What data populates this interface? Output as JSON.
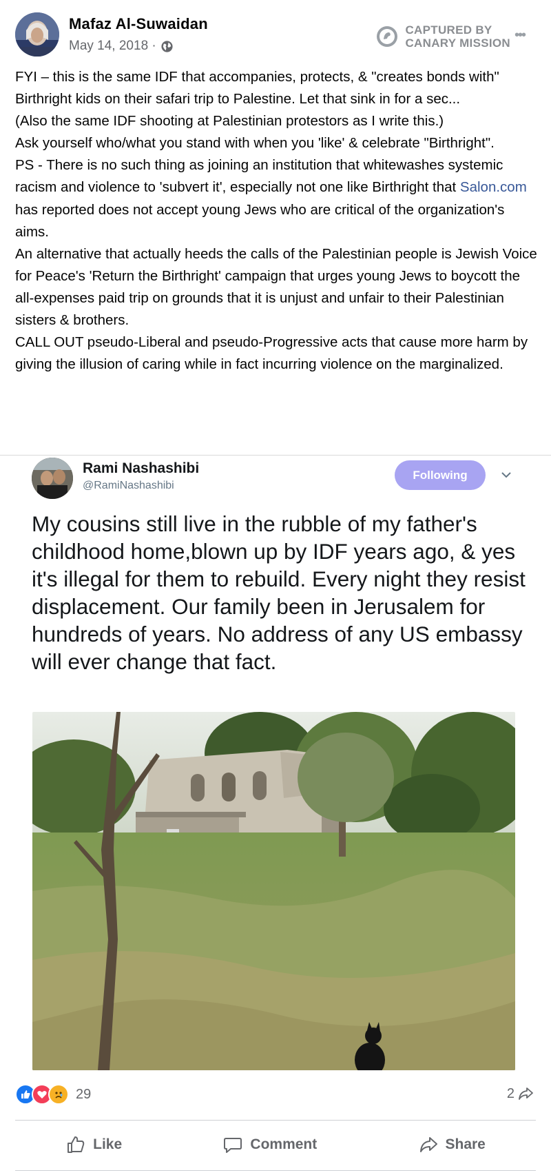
{
  "post": {
    "author": "Mafaz Al-Suwaidan",
    "date": "May 14, 2018 ·",
    "audience_icon": "globe-icon",
    "captured_line1": "CAPTURED BY",
    "captured_line2": "CANARY MISSION",
    "paragraphs": [
      "FYI – this is the same IDF that accompanies, protects, & \"creates bonds with\" Birthright kids on their safari trip to Palestine. Let that sink in for a sec...",
      "(Also the same IDF shooting at Palestinian protestors as I write this.)",
      "Ask yourself who/what you stand with when you 'like' & celebrate \"Birthright\"."
    ],
    "ps_before_link": "PS - There is no such thing as joining an institution that whitewashes systemic racism and violence to 'subvert it', especially not one like Birthright that ",
    "ps_link": "Salon.com",
    "ps_after_link": " has reported does not accept young Jews who are critical of the organization's aims.",
    "paragraphs_end": [
      "An alternative that actually heeds the calls of the Palestinian people is Jewish Voice for Peace's 'Return the Birthright' campaign that urges young Jews to boycott the all-expenses paid trip on grounds that it is unjust and unfair to their Palestinian sisters & brothers.",
      "CALL OUT pseudo-Liberal and pseudo-Progressive acts that cause more harm by giving the illusion of caring while in fact incurring violence on the marginalized."
    ]
  },
  "tweet": {
    "name": "Rami Nashashibi",
    "handle": "@RamiNashashibi",
    "follow_label": "Following",
    "text": "My cousins still live in the rubble of my father's childhood home,blown up by IDF years ago, & yes it's illegal for them to rebuild. Every night  they resist displacement. Our family been in Jerusalem for hundreds of years. No address of any US embassy will ever change that fact."
  },
  "footer": {
    "reaction_count": "29",
    "share_count": "2",
    "like_label": "Like",
    "comment_label": "Comment",
    "share_label": "Share"
  },
  "colors": {
    "link": "#385898",
    "follow_button": "#a8a4f2",
    "like_blue": "#1877f2",
    "love_red": "#f33e58",
    "sad_yellow": "#f7b125"
  }
}
